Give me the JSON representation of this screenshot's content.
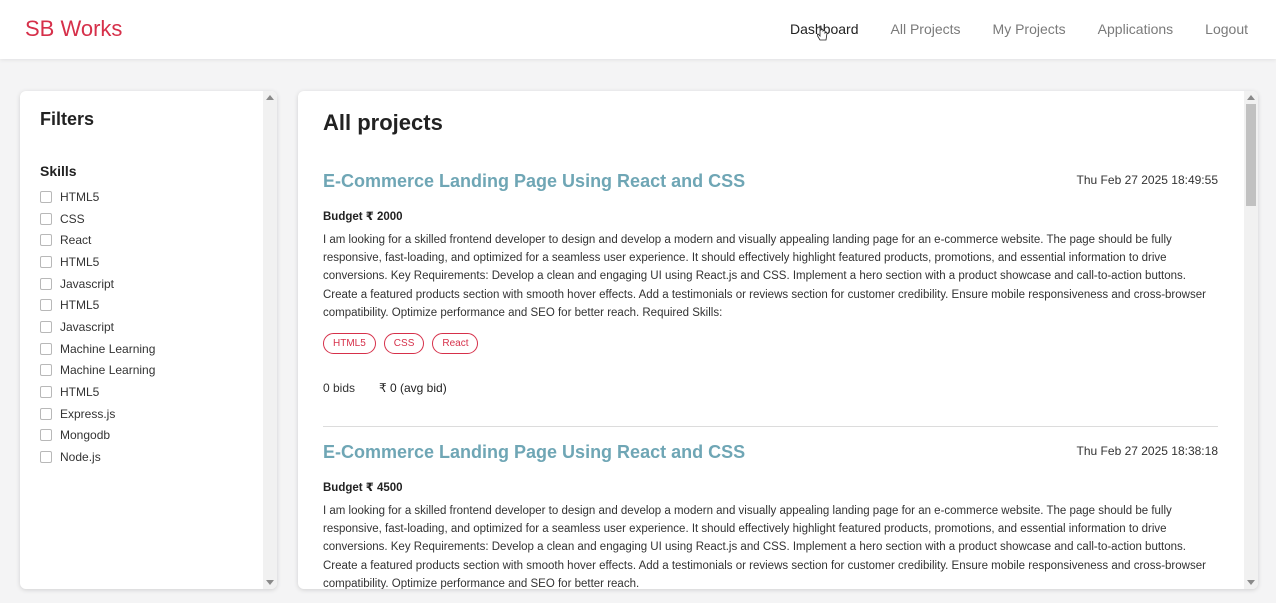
{
  "brand": "SB Works",
  "nav": {
    "items": [
      "Dashboard",
      "All Projects",
      "My Projects",
      "Applications",
      "Logout"
    ]
  },
  "filters": {
    "title": "Filters",
    "skills_label": "Skills",
    "skills": [
      "HTML5",
      "CSS",
      "React",
      "HTML5",
      "Javascript",
      "HTML5",
      "Javascript",
      "Machine Learning",
      "Machine Learning",
      "HTML5",
      "Express.js",
      "Mongodb",
      "Node.js"
    ]
  },
  "projects": {
    "title": "All projects",
    "items": [
      {
        "title": "E-Commerce Landing Page Using React and CSS",
        "date": "Thu Feb 27 2025 18:49:55",
        "budget": "Budget ₹ 2000",
        "description": "I am looking for a skilled frontend developer to design and develop a modern and visually appealing landing page for an e-commerce website. The page should be fully responsive, fast-loading, and optimized for a seamless user experience. It should effectively highlight featured products, promotions, and essential information to drive conversions. Key Requirements: Develop a clean and engaging UI using React.js and CSS. Implement a hero section with a product showcase and call-to-action buttons. Create a featured products section with smooth hover effects. Add a testimonials or reviews section for customer credibility. Ensure mobile responsiveness and cross-browser compatibility. Optimize performance and SEO for better reach. Required Skills:",
        "skills": [
          "HTML5",
          "CSS",
          "React"
        ],
        "bids": "0 bids",
        "avg_bid": "₹ 0 (avg bid)"
      },
      {
        "title": "E-Commerce Landing Page Using React and CSS",
        "date": "Thu Feb 27 2025 18:38:18",
        "budget": "Budget ₹ 4500",
        "description": "I am looking for a skilled frontend developer to design and develop a modern and visually appealing landing page for an e-commerce website. The page should be fully responsive, fast-loading, and optimized for a seamless user experience. It should effectively highlight featured products, promotions, and essential information to drive conversions. Key Requirements: Develop a clean and engaging UI using React.js and CSS. Implement a hero section with a product showcase and call-to-action buttons. Create a featured products section with smooth hover effects. Add a testimonials or reviews section for customer credibility. Ensure mobile responsiveness and cross-browser compatibility. Optimize performance and SEO for better reach."
      }
    ]
  },
  "colors": {
    "brand": "#d6304a",
    "project_title": "#6fa6b5"
  }
}
